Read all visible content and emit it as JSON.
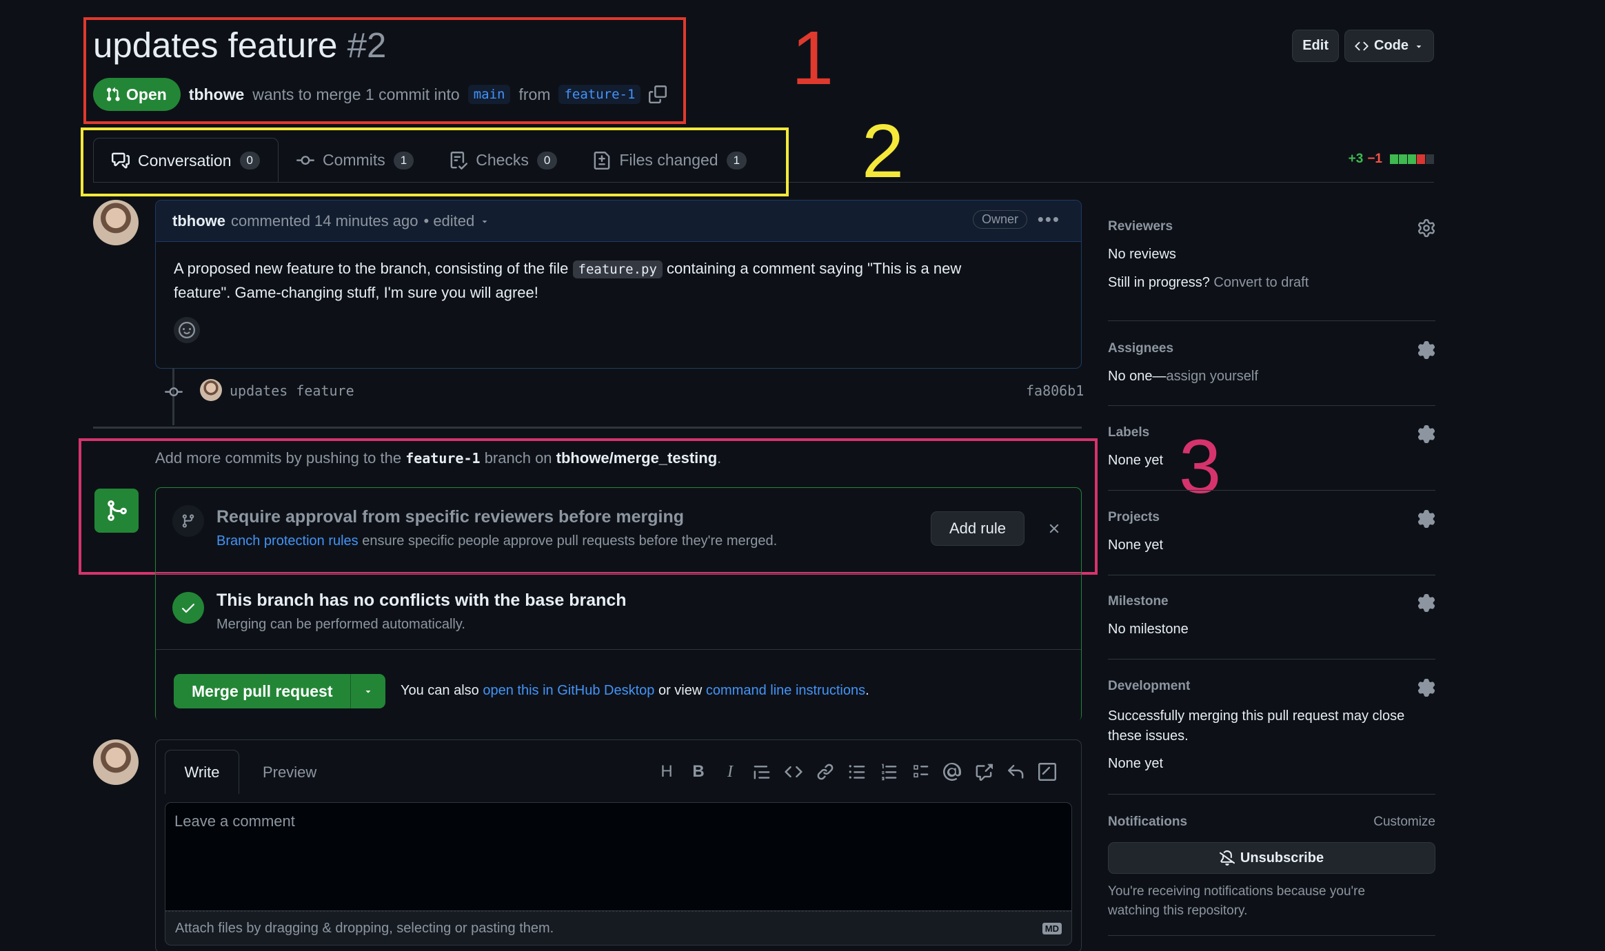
{
  "header": {
    "title": "updates feature",
    "number": "#2",
    "state": "Open",
    "author": "tbhowe",
    "merge_text_1": "wants to merge 1 commit into",
    "base_branch": "main",
    "merge_text_2": "from",
    "head_branch": "feature-1",
    "edit_label": "Edit",
    "code_label": "Code"
  },
  "annotations": {
    "one": "1",
    "two": "2",
    "three": "3"
  },
  "tabs": [
    {
      "label": "Conversation",
      "count": "0"
    },
    {
      "label": "Commits",
      "count": "1"
    },
    {
      "label": "Checks",
      "count": "0"
    },
    {
      "label": "Files changed",
      "count": "1"
    }
  ],
  "diffstat": {
    "added": "+3",
    "removed": "−1"
  },
  "comment": {
    "author": "tbhowe",
    "meta": "commented 14 minutes ago",
    "edited": "• edited",
    "badge": "Owner",
    "body_1": "A proposed new feature to the branch, consisting of the file",
    "file": "feature.py",
    "body_2": "containing a comment saying \"This is a new",
    "body_3": "feature\". Game-changing stuff, I'm sure you will agree!"
  },
  "commit": {
    "message": "updates feature",
    "sha": "fa806b1"
  },
  "push_hint": {
    "text_1": "Add more commits by pushing to the",
    "branch": "feature-1",
    "text_2": "branch on",
    "repo": "tbhowe/merge_testing",
    "text_3": "."
  },
  "rule": {
    "title": "Require approval from specific reviewers before merging",
    "link": "Branch protection rules",
    "desc": "ensure specific people approve pull requests before they're merged.",
    "button": "Add rule"
  },
  "status": {
    "title": "This branch has no conflicts with the base branch",
    "desc": "Merging can be performed automatically."
  },
  "merge": {
    "button": "Merge pull request",
    "text_1": "You can also",
    "link_1": "open this in GitHub Desktop",
    "text_2": "or view",
    "link_2": "command line instructions",
    "text_3": "."
  },
  "editor": {
    "write_tab": "Write",
    "preview_tab": "Preview",
    "placeholder": "Leave a comment",
    "attach": "Attach files by dragging & dropping, selecting or pasting them.",
    "md": "MD"
  },
  "sidebar": {
    "reviewers": {
      "title": "Reviewers",
      "value": "No reviews",
      "progress": "Still in progress?",
      "draft": "Convert to draft"
    },
    "assignees": {
      "title": "Assignees",
      "value": "No one—",
      "link": "assign yourself"
    },
    "labels": {
      "title": "Labels",
      "value": "None yet"
    },
    "projects": {
      "title": "Projects",
      "value": "None yet"
    },
    "milestone": {
      "title": "Milestone",
      "value": "No milestone"
    },
    "development": {
      "title": "Development",
      "desc_1": "Successfully merging this pull request may close",
      "desc_2": "these issues.",
      "value": "None yet"
    },
    "notifications": {
      "title": "Notifications",
      "customize": "Customize",
      "button": "Unsubscribe",
      "note_1": "You're receiving notifications because you're",
      "note_2": "watching this repository."
    }
  },
  "colors": {
    "annotation_1": "#e0392e",
    "annotation_2": "#f4e93a",
    "annotation_3": "#d6336c",
    "accent_green": "#238636",
    "link": "#4493f8"
  }
}
